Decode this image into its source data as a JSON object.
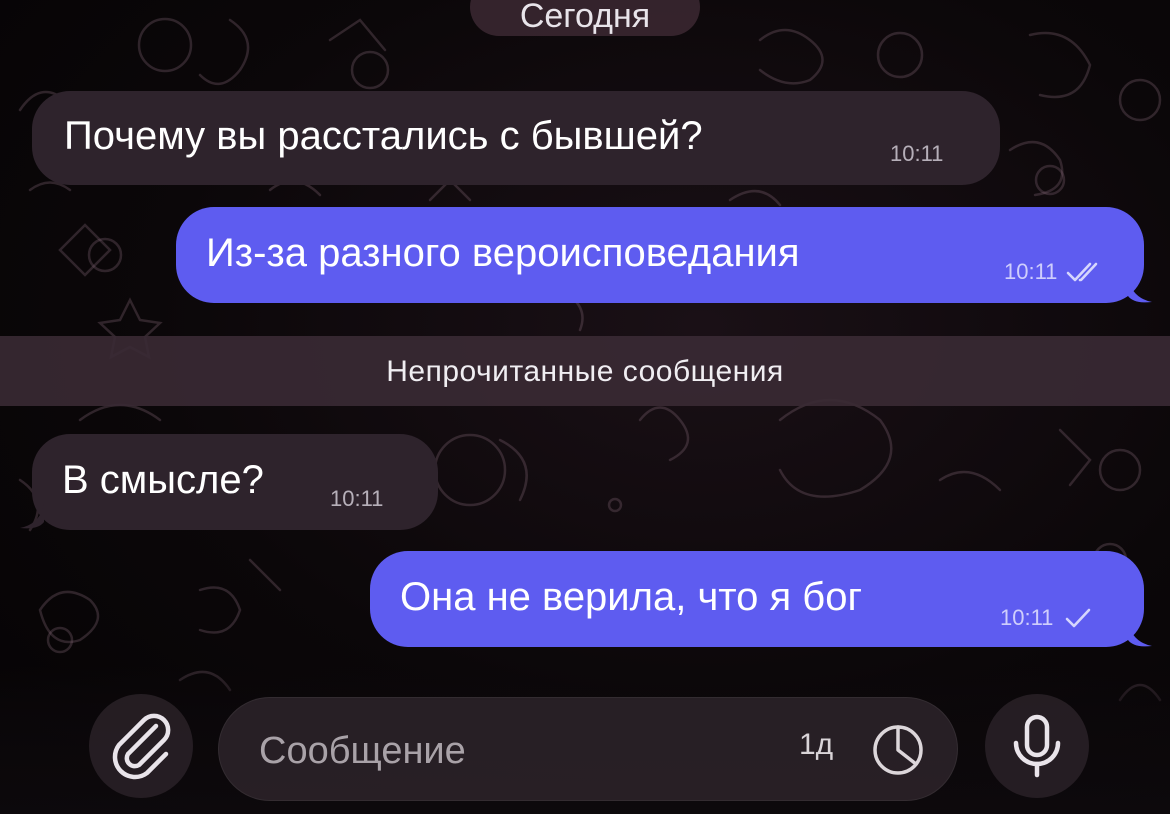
{
  "date_chip": "Сегодня",
  "messages": [
    {
      "direction": "incoming",
      "text": "Почему вы расстались с бывшей?",
      "time": "10:11"
    },
    {
      "direction": "outgoing",
      "text": "Из-за разного вероисповедания",
      "time": "10:11",
      "status": "read"
    },
    {
      "direction": "incoming",
      "text": "В смысле?",
      "time": "10:11"
    },
    {
      "direction": "outgoing",
      "text": "Она не верила, что я бог",
      "time": "10:11",
      "status": "sent"
    }
  ],
  "unread_divider": "Непрочитанные сообщения",
  "composer": {
    "placeholder": "Сообщение",
    "timer_label": "1д"
  },
  "colors": {
    "incoming_bubble": "#2e232c",
    "outgoing_bubble": "#5e5cf0",
    "background": "#0b0709"
  },
  "icons": {
    "attach": "paperclip-icon",
    "timer": "timer-icon",
    "mic": "microphone-icon",
    "read": "double-check-icon",
    "sent": "single-check-icon"
  }
}
